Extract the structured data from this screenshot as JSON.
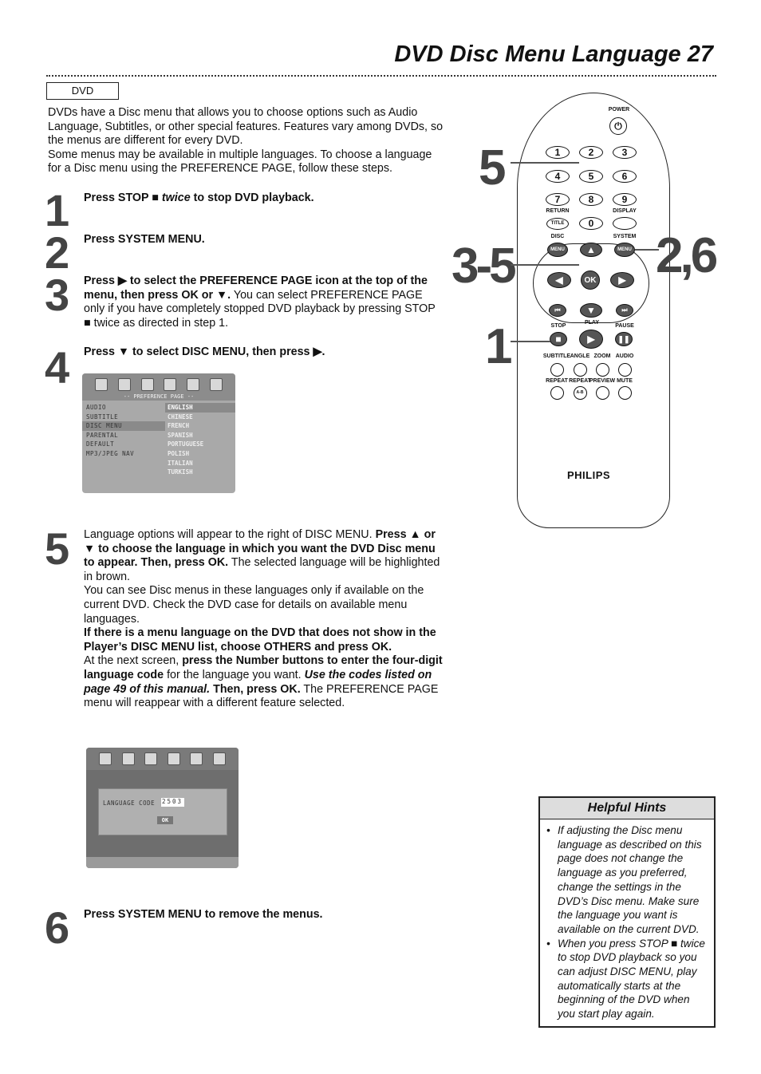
{
  "header": {
    "title": "DVD Disc Menu Language  27"
  },
  "tag": "DVD",
  "intro": [
    [
      {
        "t": "DVDs have a Disc menu that allows you to choose options such as Audio Language, Subtitles, or other special features. Features vary among DVDs, so the menus are different for every DVD."
      }
    ],
    [
      {
        "t": "Some menus may be available in multiple languages. To choose a language for a Disc menu using the PREFERENCE PAGE, follow these steps."
      }
    ]
  ],
  "steps": [
    {
      "num": "1",
      "paras": [
        [
          {
            "t": "Press STOP ■ ",
            "b": true
          },
          {
            "t": "twice",
            "b": true,
            "i": true
          },
          {
            "t": " to stop DVD playback.",
            "b": true
          }
        ]
      ]
    },
    {
      "num": "2",
      "paras": [
        [
          {
            "t": "Press SYSTEM MENU.",
            "b": true
          }
        ]
      ]
    },
    {
      "num": "3",
      "paras": [
        [
          {
            "t": "Press ▶ to select the ",
            "b": true
          },
          {
            "t": "PREFERENCE PAGE",
            "b": true
          },
          {
            "t": " icon at the top of the menu, then press OK or ▼.",
            "b": true
          },
          {
            "t": " You can select PREFERENCE PAGE only if you have completely stopped DVD playback by pressing STOP ■ twice as directed in step 1."
          }
        ]
      ]
    },
    {
      "num": "4",
      "paras": [
        [
          {
            "t": "Press ▼ to select DISC MENU, then press ▶.",
            "b": true
          }
        ]
      ]
    },
    {
      "num": "5",
      "paras": [
        [
          {
            "t": "Language options will appear to the right of DISC MENU. "
          },
          {
            "t": "Press ▲ or ▼ to choose the language in which you want the DVD Disc menu to appear. Then, press OK.",
            "b": true
          },
          {
            "t": " The selected language will be highlighted in brown."
          }
        ],
        [
          {
            "t": "You can see Disc menus in these languages only if available on the current DVD. Check the DVD case for details on available menu languages."
          }
        ],
        [
          {
            "t": "If there is a menu language on the DVD that does not show in the Player’s DISC MENU list, choose OTHERS and press OK.",
            "b": true
          }
        ],
        [
          {
            "t": "At the next screen, "
          },
          {
            "t": "press the Number buttons to enter the four-digit language code",
            "b": true
          },
          {
            "t": " for the language you want. "
          },
          {
            "t": "Use the codes listed on page 49 of this manual.",
            "b": true,
            "i": true
          },
          {
            "t": " Then, press OK.",
            "b": true
          },
          {
            "t": " The PREFERENCE PAGE menu will reappear with a different feature selected."
          }
        ]
      ]
    },
    {
      "num": "6",
      "paras": [
        [
          {
            "t": "Press SYSTEM MENU",
            "b": true
          },
          {
            "t": " to remove the menus.",
            "b": true
          }
        ]
      ]
    }
  ],
  "osd1": {
    "heading": "-- PREFERENCE PAGE --",
    "items": [
      "AUDIO",
      "SUBTITLE",
      "DISC MENU",
      "PARENTAL",
      "DEFAULT",
      "MP3/JPEG NAV"
    ],
    "selected_item": "DISC MENU",
    "languages": [
      "ENGLISH",
      "CHINESE",
      "FRENCH",
      "SPANISH",
      "PORTUGUESE",
      "POLISH",
      "ITALIAN",
      "TURKISH"
    ],
    "selected_language": "ENGLISH",
    "icons": [
      "disc-setup-icon",
      "audio-setup-icon",
      "video-setup-icon",
      "preference-page-icon",
      "lock-icon",
      "exit-icon"
    ]
  },
  "osd2": {
    "label": "LANGUAGE CODE",
    "code": "2503",
    "ok": "OK"
  },
  "remote": {
    "brand": "PHILIPS",
    "labels": {
      "power": "POWER",
      "return": "RETURN",
      "display": "DISPLAY",
      "disc": "DISC",
      "system": "SYSTEM",
      "stop": "STOP",
      "play": "PLAY",
      "pause": "PAUSE",
      "subtitle": "SUBTITLE",
      "angle": "ANGLE",
      "zoom": "ZOOM",
      "audio": "AUDIO",
      "repeat": "REPEAT",
      "repeat_ab": "REPEAT",
      "preview": "PREVIEW",
      "mute": "MUTE"
    },
    "keys": {
      "1": "1",
      "2": "2",
      "3": "3",
      "4": "4",
      "5": "5",
      "6": "6",
      "7": "7",
      "8": "8",
      "9": "9",
      "0": "0",
      "title": "TITLE",
      "menu": "MENU",
      "ok": "OK",
      "ab": "A-B"
    },
    "callouts": {
      "c5": "5",
      "c35": "3-5",
      "c1": "1",
      "c26": "2,6"
    }
  },
  "hints": {
    "title": "Helpful Hints",
    "items": [
      "If adjusting the Disc menu language as described on this page does not change the language as you preferred, change the settings in the DVD’s Disc menu. Make sure the language you want is available on the current DVD.",
      "When you press STOP ■ twice to stop DVD playback so you can adjust DISC MENU, play automatically starts at the beginning of the DVD when you start play again."
    ]
  }
}
